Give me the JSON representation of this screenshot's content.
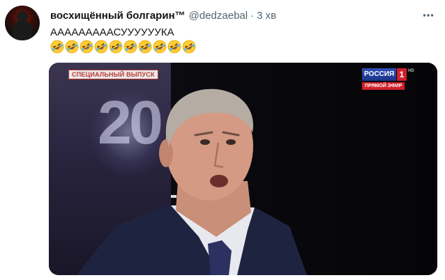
{
  "tweet": {
    "author_name": "восхищённый болгарин™",
    "handle": "@dedzaebal",
    "separator": "·",
    "time": "3 хв",
    "text": "АААААААААСУУУУУУКА",
    "emoji_count_label": "rolling-on-floor-laughing ×10",
    "emojis": [
      "🤣",
      "🤣",
      "🤣",
      "🤣",
      "🤣",
      "🤣",
      "🤣",
      "🤣",
      "🤣",
      "🤣"
    ]
  },
  "media": {
    "overlay_badge": "СПЕЦИАЛЬНЫЙ ВЫПУСК",
    "background_number": "20",
    "channel_name": "РОССИЯ",
    "channel_number": "1",
    "hd_mark": "HD",
    "live_label": "ПРЯМОЙ ЭФИР"
  },
  "colors": {
    "text_primary": "#0f1419",
    "text_secondary": "#536471",
    "channel_blue": "#1b3486",
    "channel_red": "#d0202b"
  }
}
